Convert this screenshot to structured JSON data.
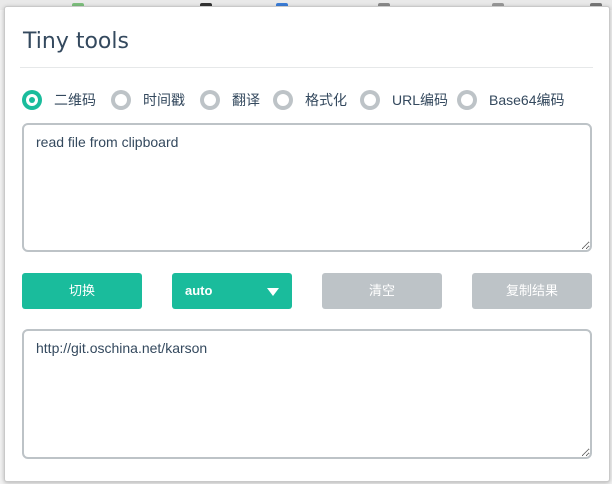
{
  "header": {
    "title": "Tiny tools"
  },
  "modes": [
    {
      "label": "二维码",
      "checked": true
    },
    {
      "label": "时间戳",
      "checked": false
    },
    {
      "label": "翻译",
      "checked": false
    },
    {
      "label": "格式化",
      "checked": false
    },
    {
      "label": "URL编码",
      "checked": false
    },
    {
      "label": "Base64编码",
      "checked": false
    }
  ],
  "input": {
    "value": "read file from clipboard"
  },
  "toolbar": {
    "switch_label": "切换",
    "select_value": "auto",
    "clear_label": "清空",
    "copy_label": "复制结果"
  },
  "output": {
    "value": "http://git.oschina.net/karson"
  },
  "colors": {
    "accent": "#1abc9c",
    "disabled": "#bdc3c7",
    "text": "#34495e"
  }
}
